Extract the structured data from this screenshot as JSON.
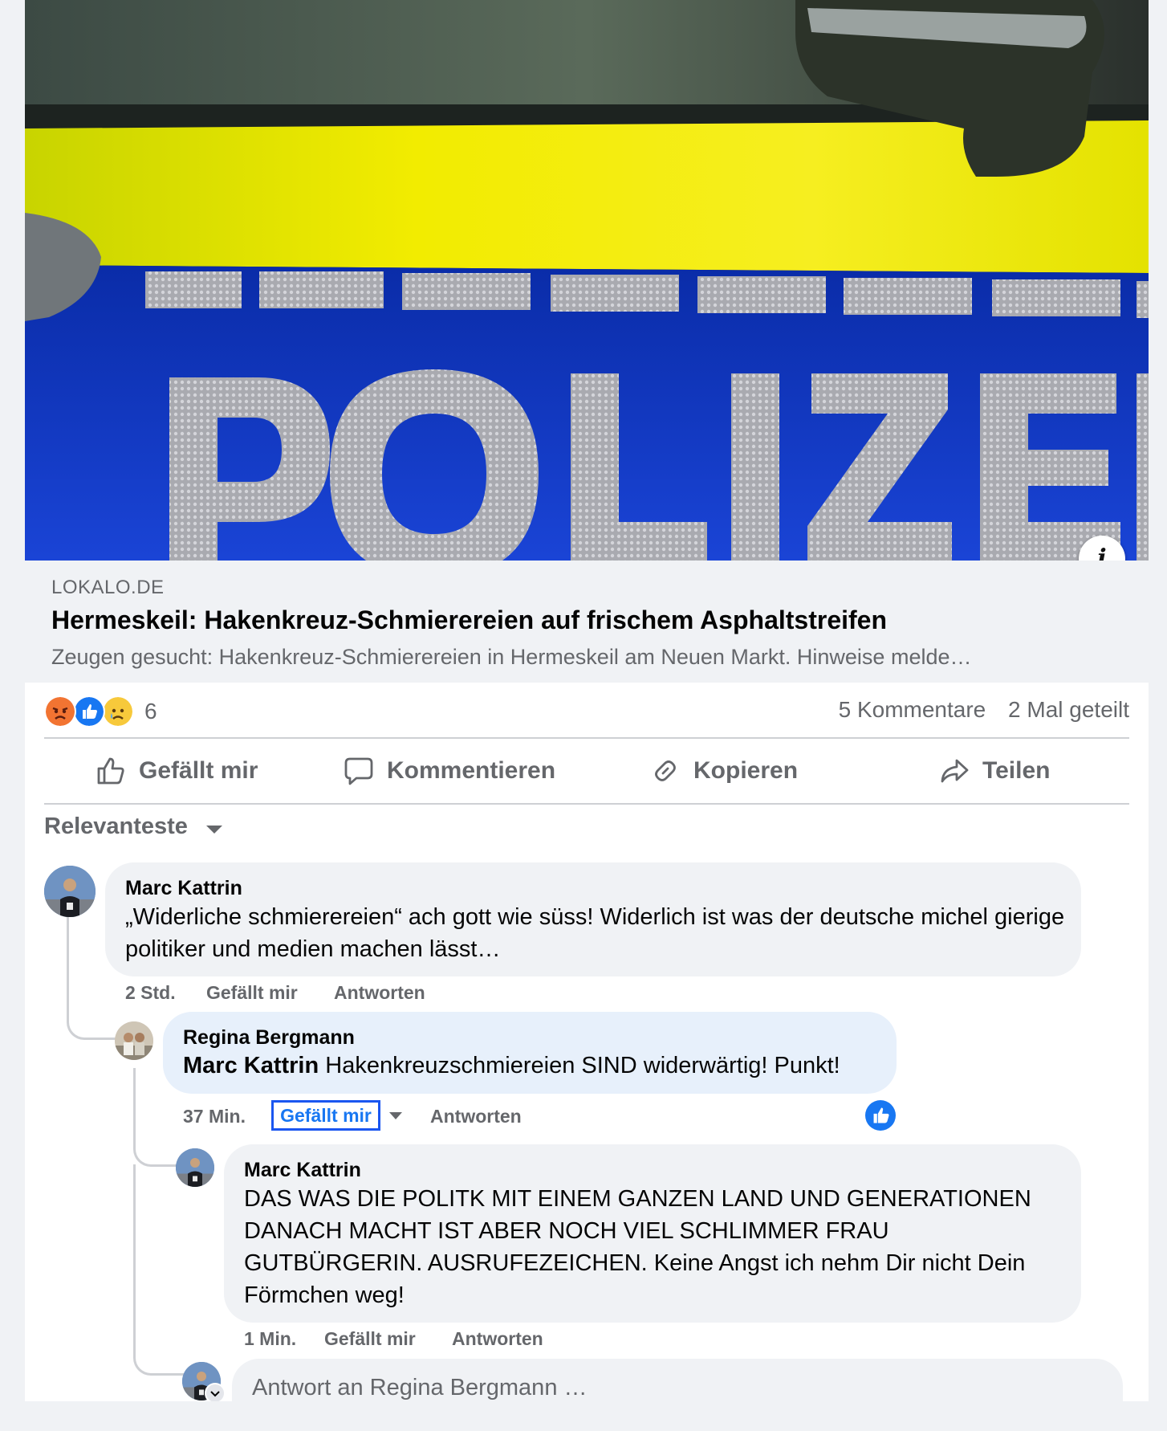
{
  "hero": {
    "image_text": "POLIZEI"
  },
  "link_preview": {
    "domain": "LOKALO.DE",
    "title": "Hermeskeil: Hakenkreuz-Schmierereien auf frischem Asphaltstreifen",
    "description": "Zeugen gesucht: Hakenkreuz-Schmierereien in Hermeskeil am Neuen Markt. Hinweise melde…"
  },
  "reactions": {
    "icons": [
      "angry-icon",
      "like-icon",
      "sad-icon"
    ],
    "count": "6",
    "comments": "5 Kommentare",
    "shares": "2 Mal geteilt"
  },
  "actions": {
    "like": "Gefällt mir",
    "comment": "Kommentieren",
    "copy": "Kopieren",
    "share": "Teilen"
  },
  "sort": {
    "label": "Relevanteste"
  },
  "comments": [
    {
      "author": "Marc Kattrin",
      "text": "„Widerliche schmierereien“ ach gott wie süss! Widerlich ist was der deutsche michel gierige politiker und medien machen lässt…",
      "time": "2 Std.",
      "like": "Gefällt mir",
      "reply": "Antworten"
    },
    {
      "author": "Regina Bergmann",
      "mention": "Marc Kattrin",
      "text": " Hakenkreuzschmiereien SIND widerwärtig! Punkt!",
      "time": "37 Min.",
      "like": "Gefällt mir",
      "reply": "Antworten"
    },
    {
      "author": "Marc Kattrin",
      "text": "DAS WAS DIE POLITK MIT EINEM GANZEN LAND UND GENERATIONEN DANACH MACHT IST ABER NOCH VIEL SCHLIMMER FRAU GUTBÜRGERIN. AUSRUFEZEICHEN. Keine Angst ich nehm Dir nicht Dein Förmchen weg!",
      "time": "1 Min.",
      "like": "Gefällt mir",
      "reply": "Antworten"
    }
  ],
  "reply_box": {
    "placeholder": "Antwort an Regina Bergmann …"
  },
  "colors": {
    "accent": "#1877f2",
    "secondary_text": "#65676b",
    "bubble": "#f0f2f5"
  }
}
